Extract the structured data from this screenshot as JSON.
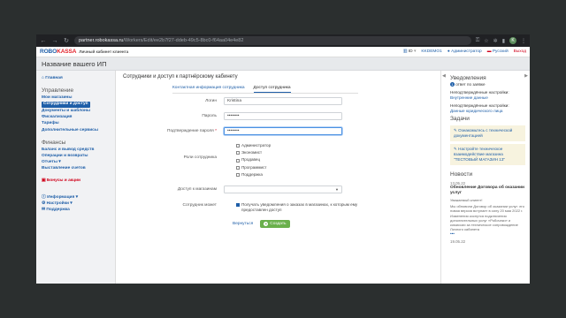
{
  "browser": {
    "host": "partner.robokassa.ru",
    "path": "/Workers/Edit/ee2b7f27-ddeb-49c5-8bc0-f64aa04e4e82",
    "profile_initial": "K"
  },
  "header": {
    "logo_robo": "ROBO",
    "logo_kassa": "KASSA",
    "subtitle": "Личный кабинет клиента",
    "id_label": "ID",
    "id_value": "KKDEMO1",
    "role": "Администратор",
    "language": "Русский",
    "logout": "Выход"
  },
  "page_title": "Название вашего ИП",
  "sidebar": {
    "home": "Главная",
    "management_heading": "Управление",
    "management_items": [
      "Мои магазины",
      "Сотрудники и доступ",
      "Документы и шаблоны",
      "Фискализация",
      "Тарифы",
      "Дополнительные сервисы"
    ],
    "finance_heading": "Финансы",
    "finance_items": [
      "Баланс и вывод средств",
      "Операции и возвраты",
      "Отчеты ▾",
      "Выставление счетов"
    ],
    "bonus": "Бонусы и акции",
    "info": "Информация ▾",
    "settings": "Настройки ▾",
    "support": "Поддержка"
  },
  "main": {
    "heading": "Сотрудники и доступ к партнёрскому кабинету",
    "tabs": [
      "Контактная информация сотрудника",
      "Доступ сотрудника"
    ],
    "form": {
      "login_label": "Логин",
      "login_value": "Kristina",
      "password_label": "Пароль",
      "password_value": "••••••••",
      "confirm_label": "Подтверждение пароля",
      "confirm_value": "••••••••",
      "roles_label": "Роли сотрудника",
      "roles": [
        "Администратор",
        "Экономист",
        "Продавец",
        "Программист",
        "Поддержка"
      ],
      "shops_label": "Доступ к магазинам",
      "employee_can_label": "Сотрудник может",
      "notify_text": "Получать уведомления о заказах в магазинах, к которым ему предоставлен доступ",
      "back": "Вернуться",
      "create": "Создать"
    }
  },
  "right": {
    "notifications_heading": "Уведомления",
    "unread_count": "1",
    "unread_text": "ответ по заявке",
    "n1_title": "Неподтверждённые настройки:",
    "n1_link": "Внутренние данные",
    "n2_title": "Неподтверждённые настройки:",
    "n2_link": "Данные юридического лица",
    "tasks_heading": "Задачи",
    "task1": "Ознакомьтесь с технической документацией",
    "task2": "Настройте техническое взаимодействие магазина \"ТЕСТОВЫЙ МАГАЗИН 13\"",
    "news_heading": "Новости",
    "news_date": "13.05.22",
    "news_title": "Обновление Договора об оказании услуг",
    "news_greeting": "Уважаемый клиент!",
    "news_body": "Мы обновили Договор об оказании услуг: его новая версия вступает в силу 20 мая 2022 г. Изменения коснутся подключения дополнительных услуг «Робочеки» и комиссии за техническое сопровождение Личного кабинета",
    "news_more": "•••",
    "news_date2": "19.05.22"
  }
}
